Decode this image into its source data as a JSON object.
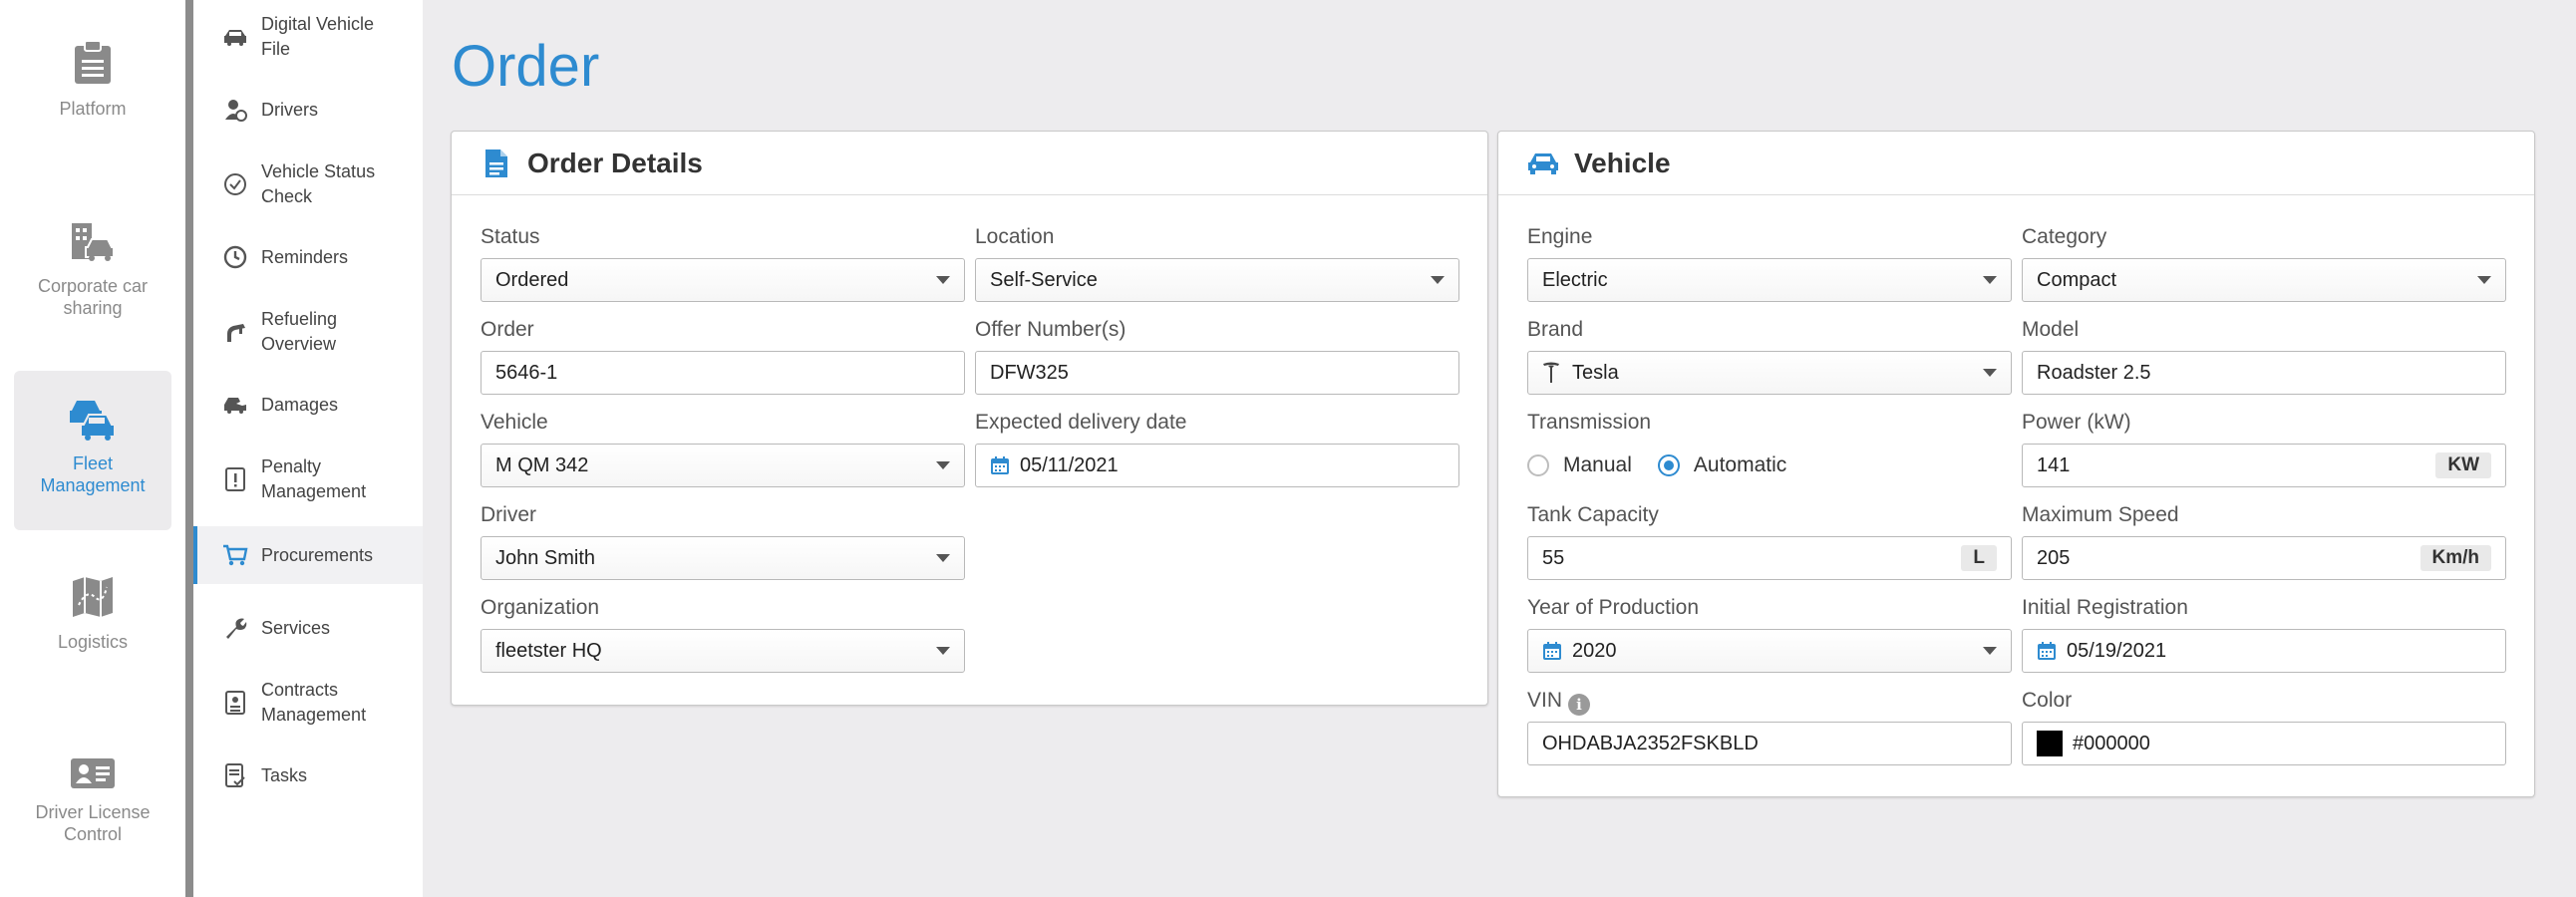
{
  "rail": {
    "items": [
      {
        "label": "Platform",
        "icon": "clipboard-icon"
      },
      {
        "label": "Corporate car sharing",
        "icon": "car-building-icon"
      },
      {
        "label": "Fleet Management",
        "icon": "cars-icon",
        "active": true
      },
      {
        "label": "Logistics",
        "icon": "map-icon"
      },
      {
        "label": "Driver License Control",
        "icon": "id-card-icon"
      }
    ]
  },
  "subnav": {
    "items": [
      {
        "label": "Digital Vehicle File",
        "icon": "car-icon"
      },
      {
        "label": "Drivers",
        "icon": "driver-icon"
      },
      {
        "label": "Vehicle Status Check",
        "icon": "check-circle-icon"
      },
      {
        "label": "Reminders",
        "icon": "clock-icon"
      },
      {
        "label": "Refueling Overview",
        "icon": "fuel-nozzle-icon"
      },
      {
        "label": "Damages",
        "icon": "damaged-car-icon"
      },
      {
        "label": "Penalty Management",
        "icon": "penalty-icon"
      },
      {
        "label": "Procurements",
        "icon": "cart-icon",
        "active": true
      },
      {
        "label": "Services",
        "icon": "wrench-icon"
      },
      {
        "label": "Contracts Management",
        "icon": "contract-icon"
      },
      {
        "label": "Tasks",
        "icon": "tasks-icon"
      }
    ]
  },
  "page": {
    "title": "Order"
  },
  "order": {
    "title": "Order Details",
    "status": {
      "label": "Status",
      "value": "Ordered"
    },
    "location": {
      "label": "Location",
      "value": "Self-Service"
    },
    "order": {
      "label": "Order",
      "value": "5646-1"
    },
    "offer": {
      "label": "Offer Number(s)",
      "value": "DFW325"
    },
    "vehicle": {
      "label": "Vehicle",
      "value": "M QM 342"
    },
    "delivery": {
      "label": "Expected delivery date",
      "value": "05/11/2021"
    },
    "driver": {
      "label": "Driver",
      "value": "John Smith"
    },
    "organization": {
      "label": "Organization",
      "value": "fleetster HQ"
    }
  },
  "vehicle": {
    "title": "Vehicle",
    "engine": {
      "label": "Engine",
      "value": "Electric"
    },
    "category": {
      "label": "Category",
      "value": "Compact"
    },
    "brand": {
      "label": "Brand",
      "value": "Tesla"
    },
    "model": {
      "label": "Model",
      "value": "Roadster 2.5"
    },
    "transmission": {
      "label": "Transmission",
      "options": [
        "Manual",
        "Automatic"
      ],
      "selected": "Automatic"
    },
    "power": {
      "label": "Power (kW)",
      "value": "141",
      "unit": "KW"
    },
    "tank": {
      "label": "Tank Capacity",
      "value": "55",
      "unit": "L"
    },
    "speed": {
      "label": "Maximum Speed",
      "value": "205",
      "unit": "Km/h"
    },
    "year": {
      "label": "Year of Production",
      "value": "2020"
    },
    "registration": {
      "label": "Initial Registration",
      "value": "05/19/2021"
    },
    "vin": {
      "label": "VIN",
      "value": "OHDABJA2352FSKBLD",
      "info_glyph": "i"
    },
    "color": {
      "label": "Color",
      "value": "#000000"
    }
  },
  "colors": {
    "accent": "#2e8bd0",
    "rail_divider": "#8c8c8c",
    "background": "#edecee"
  }
}
